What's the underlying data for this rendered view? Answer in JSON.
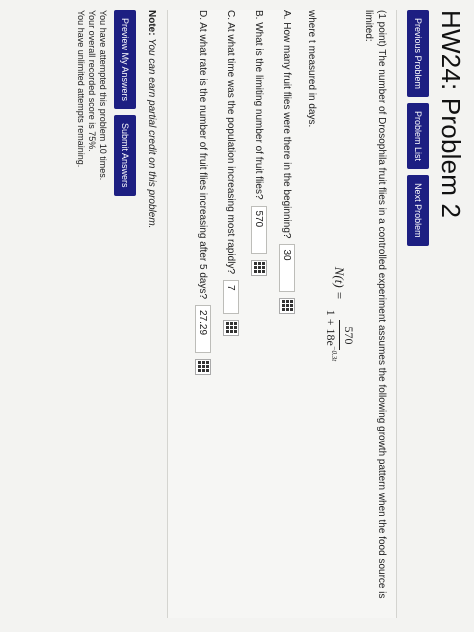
{
  "page": {
    "title": "HW24: Problem 2"
  },
  "nav": {
    "previous": "Previous Problem",
    "list": "Problem List",
    "next": "Next Problem"
  },
  "problem": {
    "intro": "(1 point) The number of Drosophila fruit flies in a controlled experiment assumes the following growth pattern when the food source is limited:",
    "formula_lhs": "N(t) =",
    "formula_num": "570",
    "formula_den_base": "1 + 18e",
    "formula_den_exp": "−0.3t",
    "where": "where t measured in days."
  },
  "questions": [
    {
      "label": "A. How many fruit flies were there in the beginning?",
      "answer": "30"
    },
    {
      "label": "B. What is the limiting number of fruit flies?",
      "answer": "570"
    },
    {
      "label": "C. At what time was the population increasing most rapidly?",
      "answer": "7"
    },
    {
      "label": "D. At what rate is the number of fruit flies increasing after 5 days?",
      "answer": "27.29"
    }
  ],
  "note": {
    "bold": "Note:",
    "text": "You can earn partial credit on this problem."
  },
  "actions": {
    "preview": "Preview My Answers",
    "submit": "Submit Answers"
  },
  "status": {
    "attempts": "You have attempted this problem 10 times.",
    "score": "Your overall recorded score is 75%.",
    "remaining": "You have unlimited attempts remaining."
  },
  "colors": {
    "button": "#1d1f82",
    "background": "#f3f3f1"
  },
  "icons": [
    "equation-editor-icon"
  ]
}
